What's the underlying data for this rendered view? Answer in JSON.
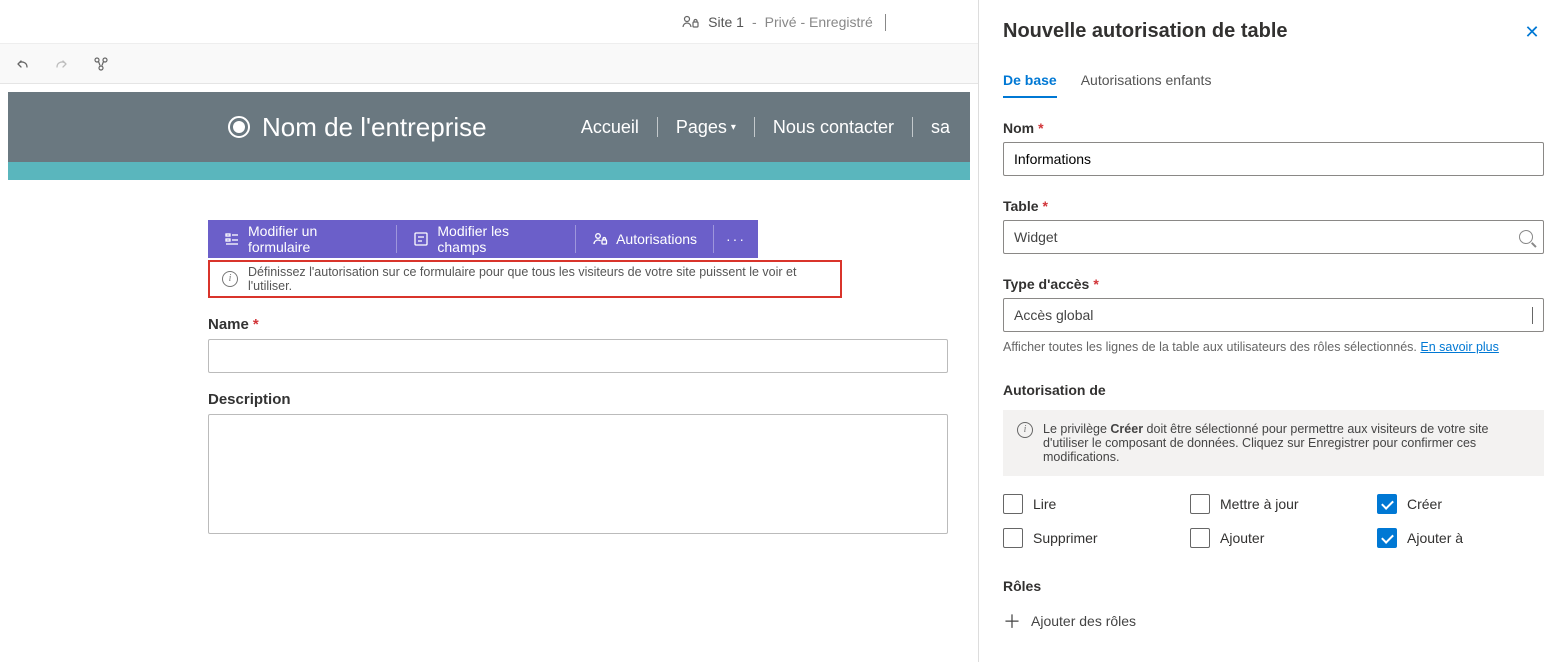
{
  "header": {
    "site_label": "Site 1",
    "status": "Privé - Enregistré"
  },
  "banner": {
    "company_name": "Nom de l'entreprise",
    "nav": {
      "home": "Accueil",
      "pages": "Pages",
      "contact": "Nous contacter",
      "sa": "sa"
    }
  },
  "form_toolbar": {
    "edit_form": "Modifier un formulaire",
    "edit_fields": "Modifier les champs",
    "permissions": "Autorisations"
  },
  "info_bar": {
    "text": "Définissez l'autorisation sur ce formulaire pour que tous les visiteurs de votre site puissent le voir et l'utiliser."
  },
  "fields": {
    "name_label": "Name",
    "desc_label": "Description"
  },
  "panel": {
    "title": "Nouvelle autorisation de table",
    "tabs": {
      "basic": "De base",
      "child": "Autorisations enfants"
    },
    "name_label": "Nom",
    "name_value": "Informations",
    "table_label": "Table",
    "table_value": "Widget",
    "access_label": "Type d'accès",
    "access_value": "Accès global",
    "access_hint_1": "Afficher toutes les lignes de la table aux utilisateurs des rôles sélectionnés. ",
    "access_hint_link": "En savoir plus",
    "auth_section": "Autorisation de",
    "info_box_prefix": "Le privilège ",
    "info_box_bold": "Créer",
    "info_box_rest": " doit être sélectionné pour permettre aux visiteurs de votre site d'utiliser le composant de données. Cliquez sur Enregistrer pour confirmer ces modifications.",
    "cb": {
      "read": "Lire",
      "update": "Mettre à jour",
      "create": "Créer",
      "delete": "Supprimer",
      "add": "Ajouter",
      "addto": "Ajouter à"
    },
    "roles_section": "Rôles",
    "add_roles": "Ajouter des rôles"
  }
}
